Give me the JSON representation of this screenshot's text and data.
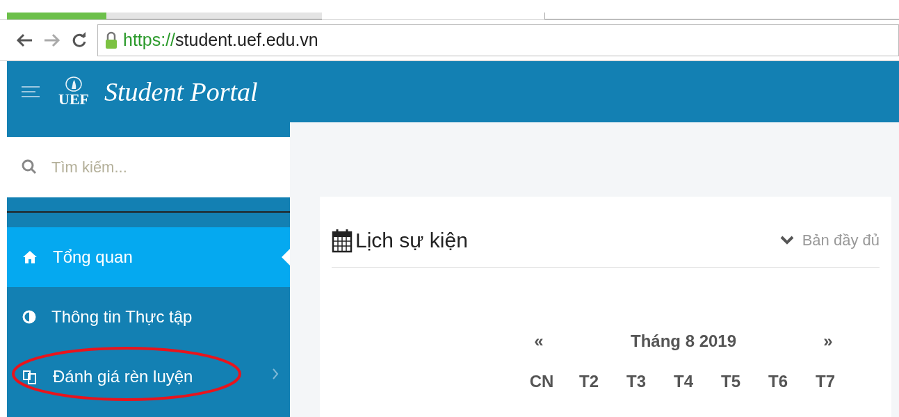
{
  "browser": {
    "url_scheme": "https://",
    "url_host": "student.uef.edu.vn"
  },
  "header": {
    "logo": "UEF",
    "title": "Student Portal"
  },
  "sidebar": {
    "search": {
      "placeholder": "Tìm kiếm..."
    },
    "items": [
      {
        "label": "Tổng quan",
        "kind": "home",
        "selected": true,
        "has_submenu": false
      },
      {
        "label": "Thông tin Thực tập",
        "kind": "contrast",
        "selected": false,
        "has_submenu": false
      },
      {
        "label": "Đánh giá rèn luyện",
        "kind": "copy",
        "selected": false,
        "has_submenu": true
      }
    ]
  },
  "card": {
    "title": "Lịch sự kiện",
    "link": "Bản đầy đủ",
    "calendar": {
      "prev": "«",
      "month": "Tháng 8 2019",
      "next": "»",
      "weekdays": [
        "CN",
        "T2",
        "T3",
        "T4",
        "T5",
        "T6",
        "T7"
      ]
    }
  }
}
